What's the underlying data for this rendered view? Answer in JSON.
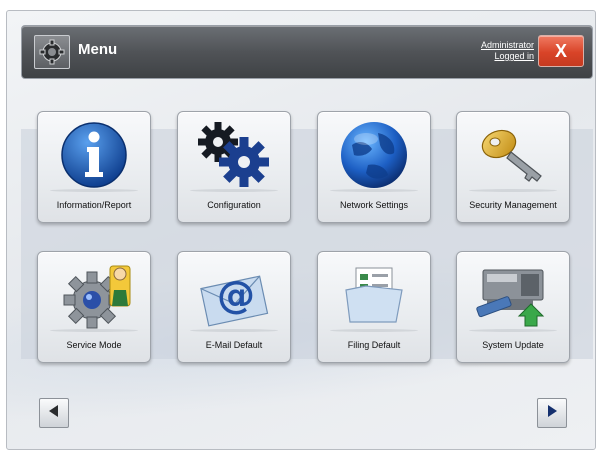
{
  "header": {
    "title": "Menu",
    "user_line1": "Administrator",
    "user_line2": "Logged in",
    "close_label": "X"
  },
  "tiles": [
    {
      "label": "Information/Report",
      "icon": "info-icon"
    },
    {
      "label": "Configuration",
      "icon": "gears-icon"
    },
    {
      "label": "Network Settings",
      "icon": "globe-icon"
    },
    {
      "label": "Security Management",
      "icon": "key-icon"
    },
    {
      "label": "Service Mode",
      "icon": "service-gear-person-icon"
    },
    {
      "label": "E-Mail Default",
      "icon": "email-at-icon"
    },
    {
      "label": "Filing Default",
      "icon": "folder-files-icon"
    },
    {
      "label": "System Update",
      "icon": "device-update-icon"
    }
  ],
  "nav": {
    "prev_icon": "triangle-left-icon",
    "next_icon": "triangle-right-icon"
  },
  "colors": {
    "title_bar": "#505357",
    "close_button": "#d94428",
    "info_blue": "#1d5fb8",
    "tile_bg": "#eef0f3"
  }
}
